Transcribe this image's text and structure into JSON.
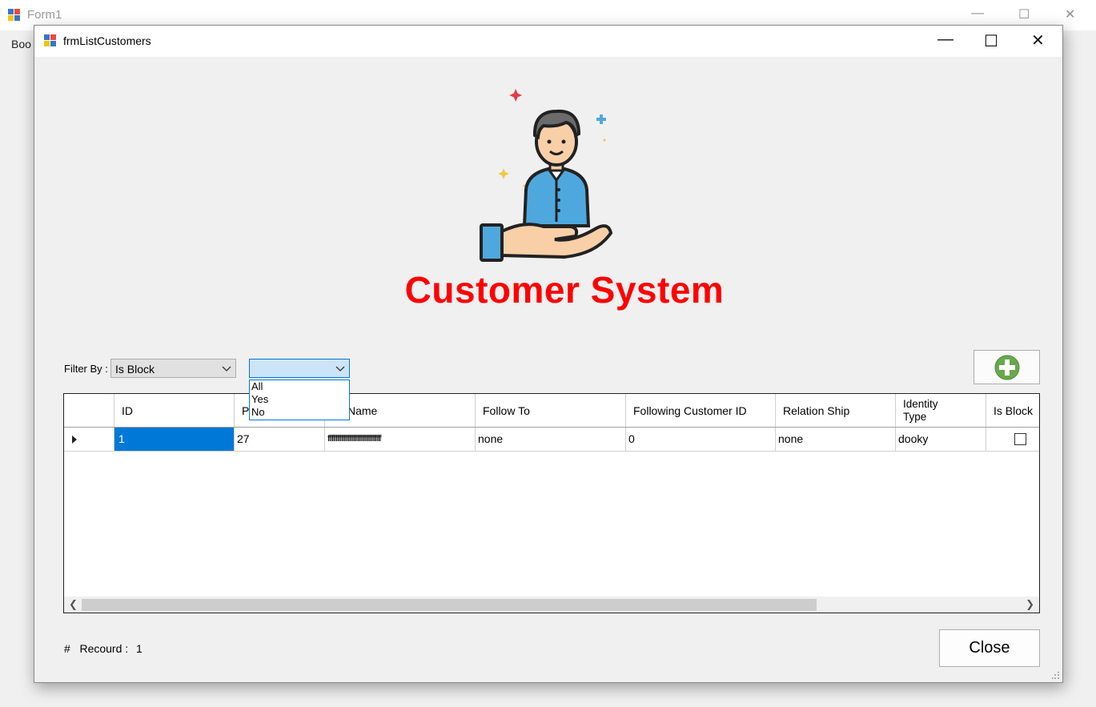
{
  "background_window": {
    "title": "Form1",
    "menu_label": "Boo",
    "controls": [
      "minimize-icon",
      "maximize-icon",
      "close-icon"
    ]
  },
  "dialog": {
    "title": "frmListCustomers",
    "controls": [
      "minimize-icon",
      "maximize-icon",
      "close-icon"
    ]
  },
  "heading": "Customer System",
  "filter": {
    "label": "Filter By :",
    "selected": "Is Block",
    "value_combo_selected": "",
    "value_options": [
      "All",
      "Yes",
      "No"
    ]
  },
  "grid": {
    "columns": [
      "ID",
      "P",
      "Name",
      "Follow To",
      "Following Customer ID",
      "Relation Ship",
      "Identity Type",
      "Is Block"
    ],
    "rows": [
      {
        "id": "1",
        "p": "27",
        "name": "ffffffffffffffffffffffffffffffffffffffff",
        "follow_to": "none",
        "following_customer_id": "0",
        "relation_ship": "none",
        "identity_type": "dooky",
        "is_block": false
      }
    ]
  },
  "footer": {
    "record_label": "#   Recourd :",
    "record_count": "1",
    "close_label": "Close"
  },
  "colors": {
    "heading": "#ff0000",
    "selection": "#0078d7",
    "add_icon": "#6aa84f"
  }
}
